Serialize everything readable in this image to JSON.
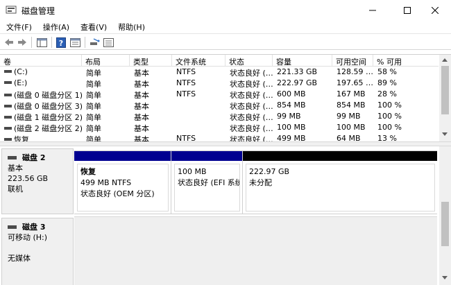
{
  "window": {
    "title": "磁盘管理"
  },
  "menu": [
    "文件(F)",
    "操作(A)",
    "查看(V)",
    "帮助(H)"
  ],
  "toolbar": {
    "icons": [
      "back-arrow-icon",
      "forward-arrow-icon",
      "console-tree-icon",
      "help-icon",
      "properties-icon",
      "rescan-icon",
      "list-view-icon"
    ]
  },
  "volume_list": {
    "columns": [
      "卷",
      "布局",
      "类型",
      "文件系统",
      "状态",
      "容量",
      "可用空间",
      "% 可用"
    ],
    "rows": [
      [
        "(C:)",
        "简单",
        "基本",
        "NTFS",
        "状态良好 (…",
        "221.33 GB",
        "128.59 …",
        "58 %"
      ],
      [
        "(E:)",
        "简单",
        "基本",
        "NTFS",
        "状态良好 (…",
        "222.97 GB",
        "197.65 …",
        "89 %"
      ],
      [
        "(磁盘 0 磁盘分区 1)",
        "简单",
        "基本",
        "NTFS",
        "状态良好 (…",
        "600 MB",
        "167 MB",
        "28 %"
      ],
      [
        "(磁盘 0 磁盘分区 3)",
        "简单",
        "基本",
        "",
        "状态良好 (…",
        "854 MB",
        "854 MB",
        "100 %"
      ],
      [
        "(磁盘 1 磁盘分区 2)",
        "简单",
        "基本",
        "",
        "状态良好 (…",
        "99 MB",
        "99 MB",
        "100 %"
      ],
      [
        "(磁盘 2 磁盘分区 2)",
        "简单",
        "基本",
        "",
        "状态良好 (…",
        "100 MB",
        "100 MB",
        "100 %"
      ],
      [
        "恢复",
        "简单",
        "基本",
        "NTFS",
        "状态良好 (…",
        "499 MB",
        "64 MB",
        "13 %"
      ]
    ]
  },
  "disks": [
    {
      "name": "磁盘 2",
      "type": "基本",
      "size": "223.56 GB",
      "status": "联机",
      "partitions": [
        {
          "title": "恢复",
          "line1": "499 MB NTFS",
          "line2": "状态良好 (OEM 分区)",
          "bar_color": "#00008b"
        },
        {
          "title": "",
          "line1": "100 MB",
          "line2": "状态良好 (EFI 系统",
          "bar_color": "#00008b"
        },
        {
          "title": "",
          "line1": "222.97 GB",
          "line2": "未分配",
          "bar_color": "#000000"
        }
      ]
    },
    {
      "name": "磁盘 3",
      "type": "可移动 (H:)",
      "size": "",
      "status": "无媒体"
    }
  ]
}
